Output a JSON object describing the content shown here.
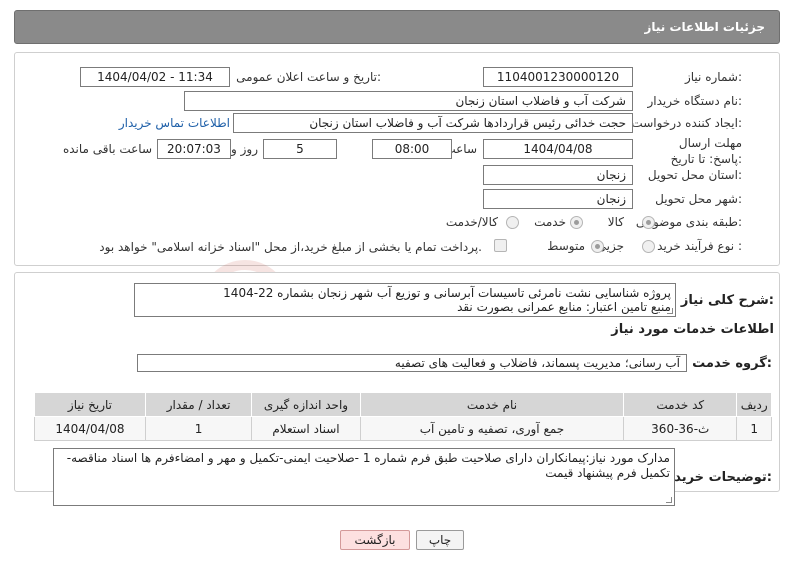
{
  "title": "جزئیات اطلاعات نیاز",
  "fields": {
    "need_number_label": "شماره نیاز:",
    "need_number": "1104001230000120",
    "announce_label": "تاریخ و ساعت اعلان عمومی:",
    "announce_value": "1404/04/02 - 11:34",
    "buyer_label": "نام دستگاه خریدار:",
    "buyer_value": "شرکت آب و فاضلاب استان زنجان",
    "creator_label": "ایجاد کننده درخواست:",
    "creator_value": "حجت  خدائی رئیس قراردادها شرکت آب و فاضلاب استان زنجان",
    "contact_link": "اطلاعات تماس خریدار",
    "deadline_label": "مهلت ارسال پاسخ: تا تاریخ:",
    "deadline_date": "1404/04/08",
    "time_label": "ساعت",
    "deadline_time": "08:00",
    "days_value": "5",
    "days_label": "روز و",
    "remaining_time": "20:07:03",
    "remaining_label": "ساعت باقی مانده",
    "province_label": "استان محل تحویل:",
    "province_value": "زنجان",
    "city_label": "شهر محل تحویل:",
    "city_value": "زنجان",
    "category_label": "طبقه بندی موضوعی:",
    "category_options": [
      "کالا",
      "خدمت",
      "کالا/خدمت"
    ],
    "process_label": "نوع فرآیند خرید :",
    "process_options": [
      "جزیی",
      "متوسط"
    ],
    "payment_text": "پرداخت تمام یا بخشی از مبلغ خرید،از محل \"اسناد خزانه اسلامی\" خواهد بود."
  },
  "summary": {
    "label": "شرح کلی نیاز:",
    "line1": "پروژه شناسایی نشت نامرئی تاسیسات آبرسانی و توزیع آب شهر زنجان بشماره 22-1404",
    "line2": "منبع تامین اعتبار: منابع عمرانی بصورت نقد"
  },
  "services": {
    "section_title": "اطلاعات خدمات مورد نیاز",
    "group_label": "گروه خدمت:",
    "group_value": "آب رسانی؛ مدیریت پسماند، فاضلاب و فعالیت های تصفیه",
    "columns": [
      "ردیف",
      "کد خدمت",
      "نام خدمت",
      "واحد اندازه گیری",
      "تعداد / مقدار",
      "تاریخ نیاز"
    ],
    "rows": [
      [
        "1",
        "ث-36-360",
        "جمع آوری، تصفیه و تامین آب",
        "اسناد استعلام",
        "1",
        "1404/04/08"
      ]
    ]
  },
  "notes": {
    "label": "توضیحات خریدار:",
    "text": "مدارک مورد نیاز:پیمانکاران دارای صلاحیت طبق فرم شماره 1 -صلاحیت ایمنی-تکمیل و مهر و امضاءفرم ها اسناد مناقصه-تکمیل فرم پیشنهاد قیمت"
  },
  "buttons": {
    "print": "چاپ",
    "back": "بازگشت"
  },
  "watermark_text": "AriaTender.neT",
  "colors": {
    "title_bar": "#8a8a8a",
    "link": "#1e5fa8",
    "back_button_bg": "#fde0e0",
    "watermark": "#c0392b"
  }
}
